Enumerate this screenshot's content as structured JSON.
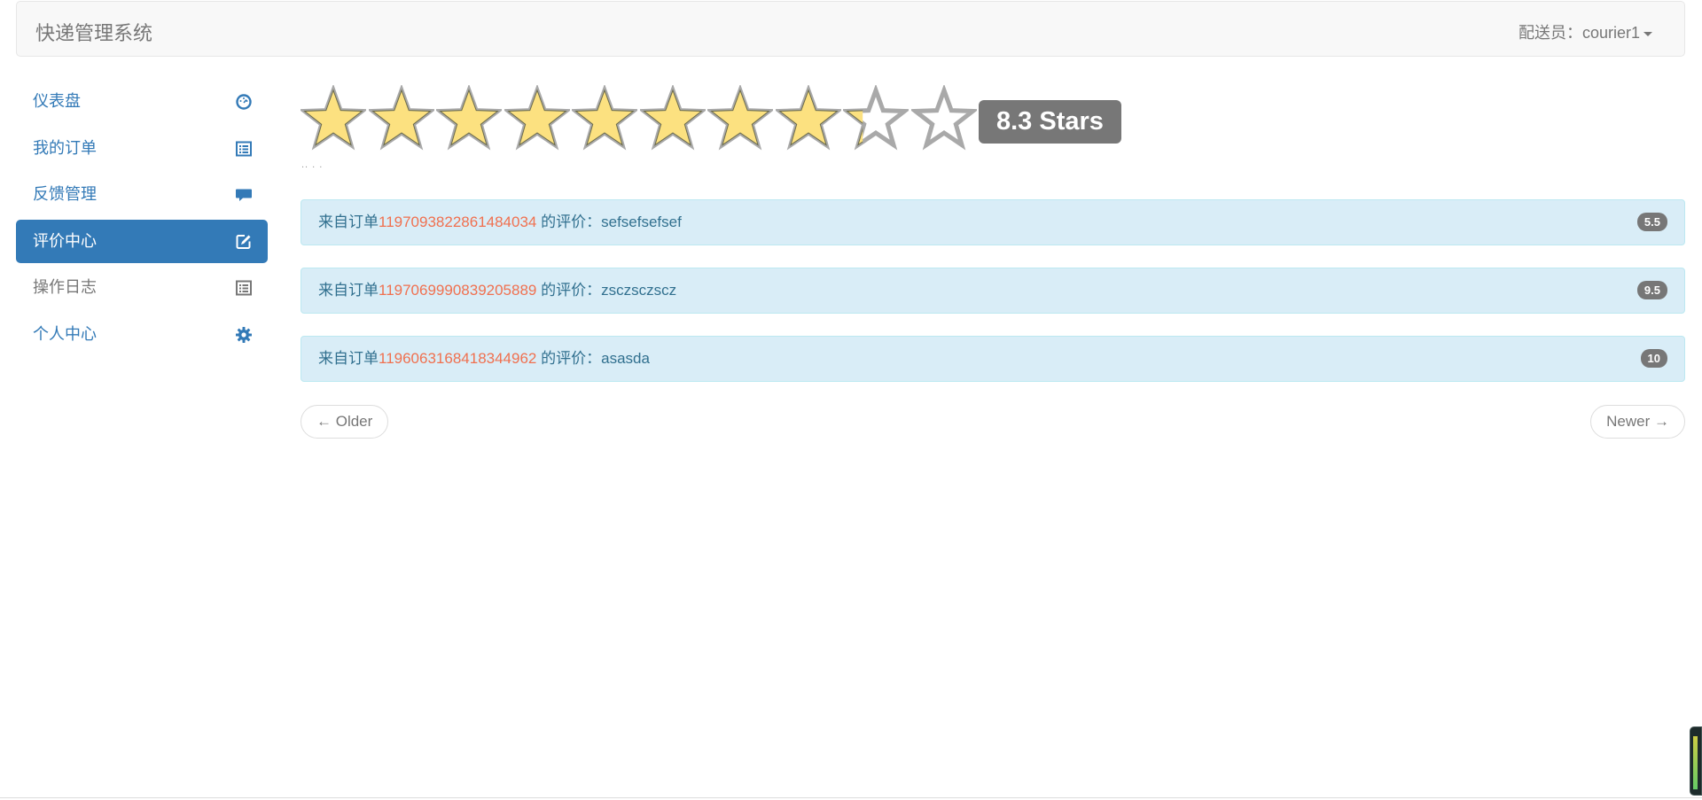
{
  "navbar": {
    "brand": "快递管理系统",
    "user_label": "配送员：courier1"
  },
  "sidebar": {
    "items": [
      {
        "label": "仪表盘",
        "icon": "dashboard-icon",
        "state": "link"
      },
      {
        "label": "我的订单",
        "icon": "list-alt-icon",
        "state": "link"
      },
      {
        "label": "反馈管理",
        "icon": "comment-icon",
        "state": "link"
      },
      {
        "label": "评价中心",
        "icon": "edit-icon",
        "state": "active"
      },
      {
        "label": "操作日志",
        "icon": "list-icon",
        "state": "muted"
      },
      {
        "label": "个人中心",
        "icon": "gear-icon",
        "state": "link"
      }
    ]
  },
  "rating": {
    "value": 8.3,
    "max_stars": 10,
    "badge": "8.3 Stars",
    "caption": ".. . ."
  },
  "reviews": [
    {
      "prefix": "来自订单",
      "order_id": "1197093822861484034",
      "mid": " 的评价：",
      "text": "sefsefsefsef",
      "score": "5.5"
    },
    {
      "prefix": "来自订单",
      "order_id": "1197069990839205889",
      "mid": " 的评价：",
      "text": "zsczsczscz",
      "score": "9.5"
    },
    {
      "prefix": "来自订单",
      "order_id": "1196063168418344962",
      "mid": " 的评价：",
      "text": "asasda",
      "score": "10"
    }
  ],
  "pager": {
    "older": "← Older",
    "newer": "Newer →"
  },
  "colors": {
    "primary": "#337ab7",
    "star_fill": "#fce180",
    "star_empty": "#a9a9a9",
    "order_id": "#f0704f",
    "review_bg": "#d9edf7"
  }
}
